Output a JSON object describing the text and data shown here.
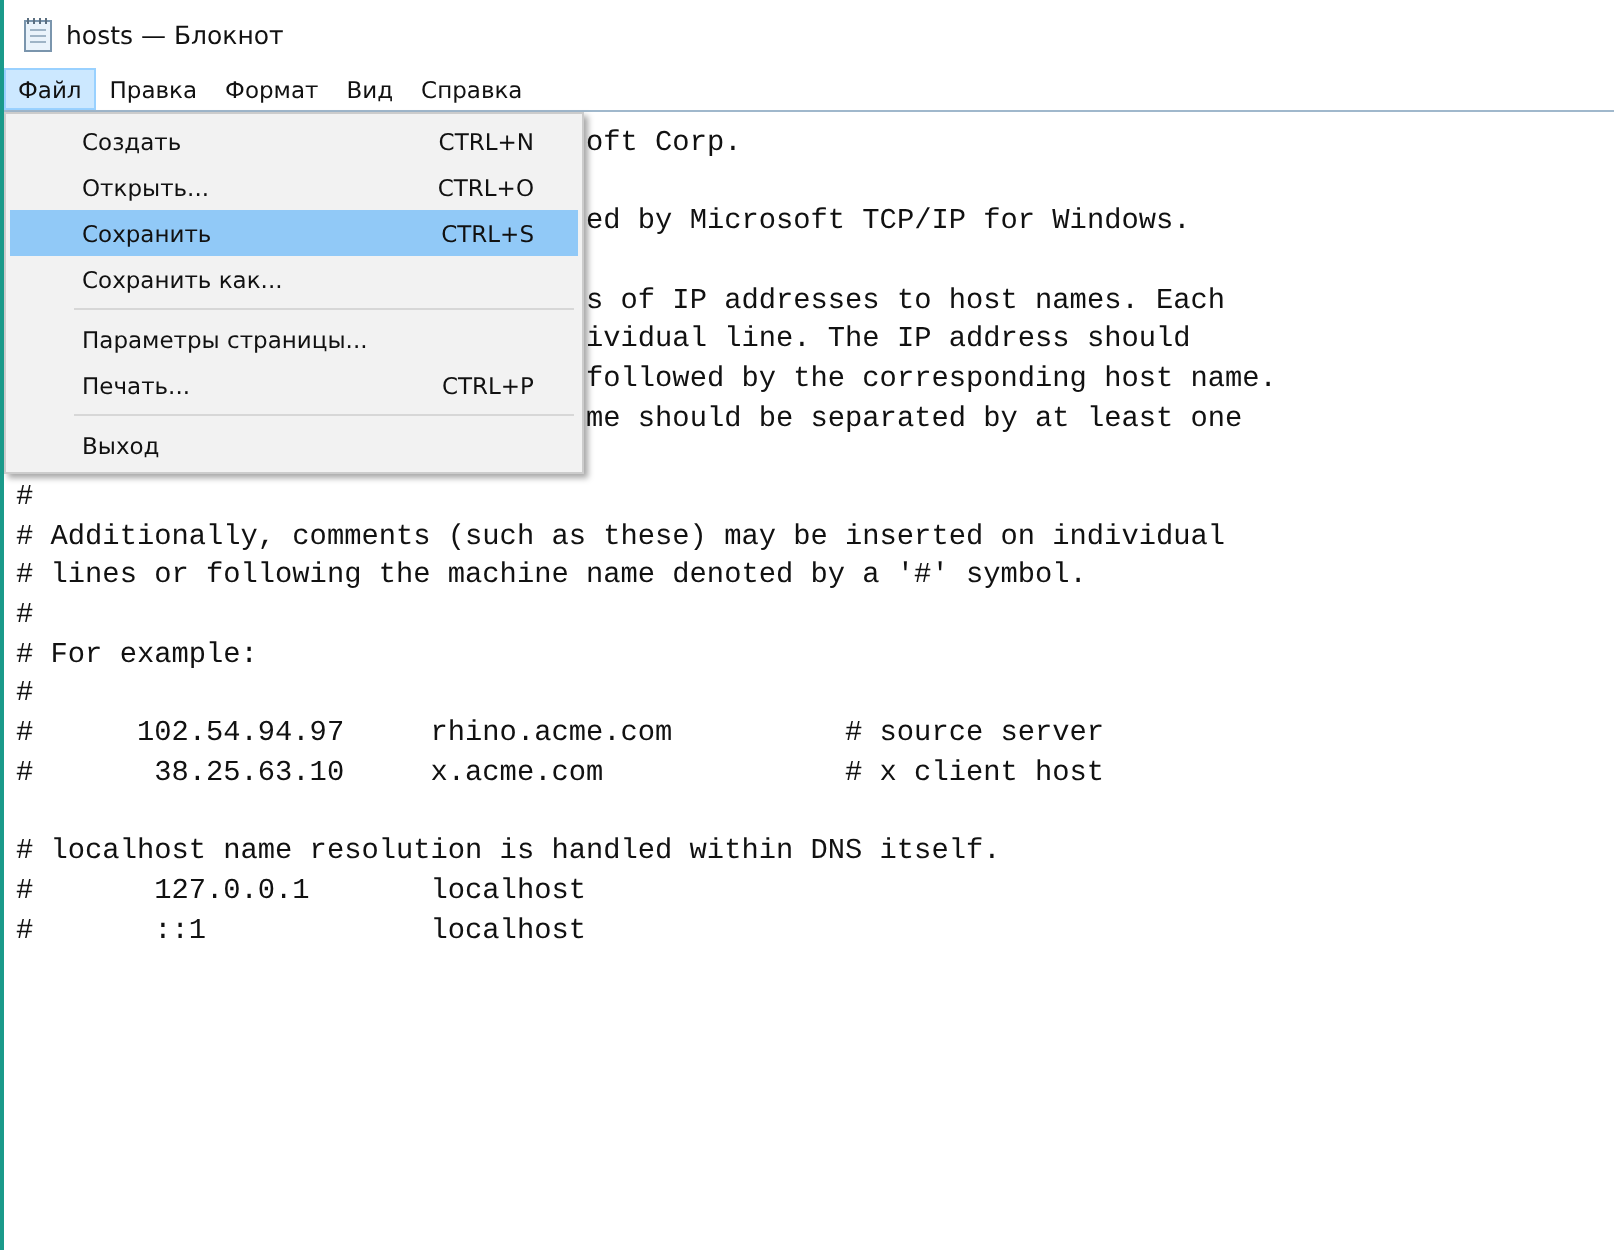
{
  "window": {
    "title": "hosts — Блокнот"
  },
  "menu_bar": [
    {
      "label": "Файл",
      "selected": true
    },
    {
      "label": "Правка",
      "selected": false
    },
    {
      "label": "Формат",
      "selected": false
    },
    {
      "label": "Вид",
      "selected": false
    },
    {
      "label": "Справка",
      "selected": false
    }
  ],
  "file_menu": {
    "items": [
      {
        "kind": "item",
        "label": "Создать",
        "shortcut": "CTRL+N",
        "selected": false
      },
      {
        "kind": "item",
        "label": "Открыть...",
        "shortcut": "CTRL+O",
        "selected": false
      },
      {
        "kind": "item",
        "label": "Сохранить",
        "shortcut": "CTRL+S",
        "selected": true
      },
      {
        "kind": "item",
        "label": "Сохранить как...",
        "selected": false
      },
      {
        "kind": "separator"
      },
      {
        "kind": "item",
        "label": "Параметры страницы...",
        "selected": false
      },
      {
        "kind": "item",
        "label": "Печать...",
        "shortcut": "CTRL+P",
        "selected": false
      },
      {
        "kind": "separator"
      },
      {
        "kind": "item",
        "label": "Выход",
        "selected": false
      }
    ]
  },
  "editor": {
    "lines": [
      {
        "kind": "partial",
        "text": "oft Corp."
      },
      {
        "kind": "blank"
      },
      {
        "kind": "partial",
        "text": "ed by Microsoft TCP/IP for Windows."
      },
      {
        "kind": "blank"
      },
      {
        "kind": "partial",
        "text": "s of IP addresses to host names. Each"
      },
      {
        "kind": "partial",
        "text": "ividual line. The IP address should"
      },
      {
        "kind": "partial",
        "text": "followed by the corresponding host name."
      },
      {
        "kind": "partial",
        "text": "me should be separated by at least one"
      },
      {
        "kind": "blank"
      },
      {
        "kind": "full",
        "text": "#"
      },
      {
        "kind": "full",
        "text": "# Additionally, comments (such as these) may be inserted on individual"
      },
      {
        "kind": "full",
        "text": "# lines or following the machine name denoted by a '#' symbol."
      },
      {
        "kind": "full",
        "text": "#"
      },
      {
        "kind": "full",
        "text": "# For example:"
      },
      {
        "kind": "full",
        "text": "#"
      },
      {
        "kind": "full",
        "text": "#      102.54.94.97     rhino.acme.com          # source server"
      },
      {
        "kind": "full",
        "text": "#       38.25.63.10     x.acme.com              # x client host"
      },
      {
        "kind": "blank"
      },
      {
        "kind": "full",
        "text": "# localhost name resolution is handled within DNS itself."
      },
      {
        "kind": "full",
        "text": "#       127.0.0.1       localhost"
      },
      {
        "kind": "full",
        "text": "#       ::1             localhost"
      }
    ]
  }
}
